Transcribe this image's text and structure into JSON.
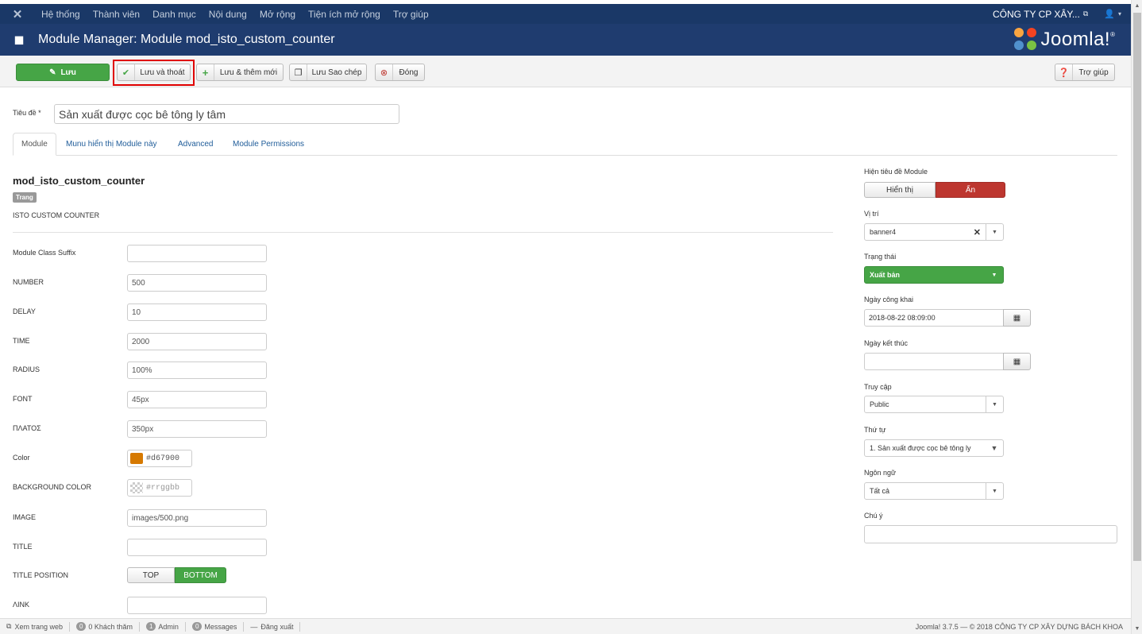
{
  "topnav": {
    "menu": [
      "Hệ thống",
      "Thành viên",
      "Danh mục",
      "Nội dung",
      "Mở rộng",
      "Tiện ích mở rộng",
      "Trợ giúp"
    ],
    "company": "CÔNG TY CP XÂY...",
    "ext_icon": "external-link-icon",
    "user_icon": "user-icon"
  },
  "header": {
    "title": "Module Manager: Module mod_isto_custom_counter",
    "brand": "Joomla!",
    "brand_tm": "®"
  },
  "toolbar": {
    "save": "Lưu",
    "save_close": "Lưu và thoát",
    "save_new": "Lưu & thêm mới",
    "save_copy": "Lưu Sao chép",
    "close": "Đóng",
    "help": "Trợ giúp"
  },
  "form": {
    "title_label": "Tiêu đề *",
    "title_value": "Sản xuất được cọc bê tông ly tâm"
  },
  "tabs": [
    "Module",
    "Munu hiển thị Module này",
    "Advanced",
    "Module Permissions"
  ],
  "module": {
    "name": "mod_isto_custom_counter",
    "badge": "Trang",
    "description": "ISTO CUSTOM COUNTER"
  },
  "fields": {
    "suffix": {
      "label": "Module Class Suffix",
      "value": ""
    },
    "number": {
      "label": "NUMBER",
      "value": "500"
    },
    "delay": {
      "label": "DELAY",
      "value": "10"
    },
    "time": {
      "label": "TIME",
      "value": "2000"
    },
    "radius": {
      "label": "RADIUS",
      "value": "100%"
    },
    "font": {
      "label": "FONT",
      "value": "45px"
    },
    "width": {
      "label": "ΠΛΑΤΟΣ",
      "value": "350px"
    },
    "color": {
      "label": "Color",
      "value": "#d67900",
      "swatch": "#d67900"
    },
    "bgcolor": {
      "label": "BACKGROUND COLOR",
      "value": "#rrggbb"
    },
    "image": {
      "label": "IMAGE",
      "value": "images/500.png"
    },
    "title": {
      "label": "TITLE",
      "value": ""
    },
    "title_position": {
      "label": "TITLE POSITION",
      "options": [
        "TOP",
        "BOTTOM"
      ],
      "selected": "BOTTOM"
    },
    "link": {
      "label": "ΛINK",
      "value": ""
    }
  },
  "right": {
    "show_title": {
      "label": "Hiện tiêu đề Module",
      "options": [
        "Hiển thị",
        "Ẩn"
      ],
      "selected": "Ẩn"
    },
    "position": {
      "label": "Vị trí",
      "value": "banner4"
    },
    "status": {
      "label": "Trạng thái",
      "value": "Xuất bản"
    },
    "publish_up": {
      "label": "Ngày công khai",
      "value": "2018-08-22 08:09:00"
    },
    "publish_down": {
      "label": "Ngày kết thúc",
      "value": ""
    },
    "access": {
      "label": "Truy cập",
      "value": "Public"
    },
    "ordering": {
      "label": "Thứ tự",
      "value": "1. Sản xuất được cọc bê tông ly"
    },
    "language": {
      "label": "Ngôn ngữ",
      "value": "Tất cả"
    },
    "note": {
      "label": "Chú ý",
      "value": ""
    }
  },
  "statusbar": {
    "view_site": "Xem trang web",
    "visitors_count": "0",
    "visitors_label": "0 Khách thăm",
    "admin_count": "1",
    "admin_label": "Admin",
    "messages_count": "0",
    "messages_label": "Messages",
    "logout": "Đăng xuất",
    "footer": "Joomla! 3.7.5 — © 2018 CÔNG TY CP XÂY DỰNG BÁCH KHOA"
  }
}
